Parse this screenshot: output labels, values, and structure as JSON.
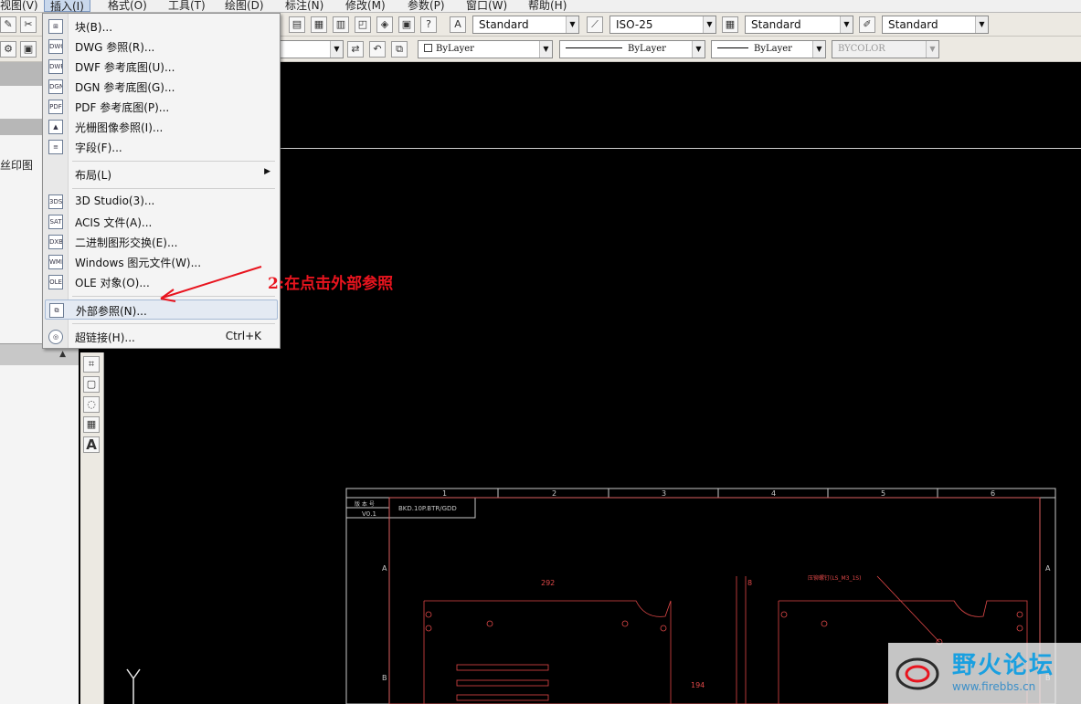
{
  "menubar": {
    "items": [
      "视图(V)",
      "插入(I)",
      "格式(O)",
      "工具(T)",
      "绘图(D)",
      "标注(N)",
      "修改(M)",
      "参数(P)",
      "窗口(W)",
      "帮助(H)"
    ],
    "active": "插入(I)"
  },
  "toolbar": {
    "text_style": "Standard",
    "dim_style": "ISO-25",
    "table_style": "Standard",
    "mleader_style": "Standard",
    "layer_color": "ByLayer",
    "linetype": "ByLayer",
    "lineweight": "ByLayer",
    "plotstyle": "BYCOLOR"
  },
  "left_panel": {
    "label": "丝印图"
  },
  "insert_menu": {
    "items": [
      {
        "label": "块(B)...",
        "icon": "block-icon",
        "shortcut": ""
      },
      {
        "label": "DWG 参照(R)...",
        "icon": "dwg-reference-icon",
        "shortcut": ""
      },
      {
        "label": "DWF 参考底图(U)...",
        "icon": "dwf-underlay-icon",
        "shortcut": ""
      },
      {
        "label": "DGN 参考底图(G)...",
        "icon": "dgn-underlay-icon",
        "shortcut": ""
      },
      {
        "label": "PDF 参考底图(P)...",
        "icon": "pdf-underlay-icon",
        "shortcut": ""
      },
      {
        "label": "光栅图像参照(I)...",
        "icon": "raster-image-icon",
        "shortcut": ""
      },
      {
        "label": "字段(F)...",
        "icon": "field-icon",
        "shortcut": ""
      },
      {
        "label": "布局(L)",
        "icon": "",
        "shortcut": ""
      },
      {
        "label": "3D Studio(3)...",
        "icon": "3ds-import-icon",
        "shortcut": ""
      },
      {
        "label": "ACIS 文件(A)...",
        "icon": "acis-import-icon",
        "shortcut": ""
      },
      {
        "label": "二进制图形交换(E)...",
        "icon": "dxb-import-icon",
        "shortcut": ""
      },
      {
        "label": "Windows 图元文件(W)...",
        "icon": "wmf-import-icon",
        "shortcut": ""
      },
      {
        "label": "OLE 对象(O)...",
        "icon": "ole-object-icon",
        "shortcut": ""
      },
      {
        "label": "外部参照(N)...",
        "icon": "xref-palette-icon",
        "shortcut": ""
      },
      {
        "label": "超链接(H)...",
        "icon": "hyperlink-icon",
        "shortcut": "Ctrl+K"
      }
    ],
    "highlighted": "外部参照(N)..."
  },
  "annotation": {
    "text": "2:在点击外部参照",
    "color": "#e8141e"
  },
  "cad_drawing": {
    "column_numbers": [
      "1",
      "2",
      "3",
      "4",
      "5",
      "6"
    ],
    "row_letters": [
      "A",
      "B"
    ],
    "title_cell": "版 本 号",
    "version": "V0.1",
    "drawing_no": "BKD.10P.BTR/GDD",
    "dim_top": "292",
    "dim_small": "8",
    "dim_side": "194",
    "callout": "压铆螺钉(LS_M3_1S)"
  },
  "watermark": {
    "title": "野火论坛",
    "url": "www.firebbs.cn"
  },
  "colors": {
    "drawing_bg": "#000000",
    "frame": "#c8c8c8",
    "part_line": "#e04848"
  }
}
